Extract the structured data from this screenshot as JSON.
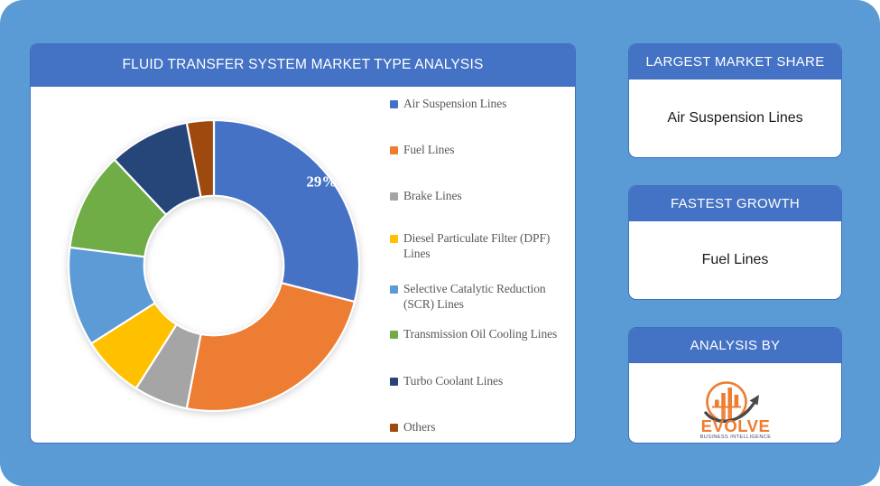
{
  "theme": {
    "background_blue": "#5B9BD5",
    "header_blue": "#4472C4",
    "panel_white": "#FFFFFF",
    "legend_text": "#595959"
  },
  "chart_panel": {
    "title": "FLUID TRANSFER SYSTEM MARKET TYPE ANALYSIS"
  },
  "chart_data": {
    "type": "pie",
    "variant": "donut",
    "title": "FLUID TRANSFER SYSTEM MARKET TYPE ANALYSIS",
    "xlabel": "",
    "ylabel": "",
    "legend_position": "right",
    "grid": false,
    "hole_ratio": 0.48,
    "start_angle_deg": 0,
    "direction": "clockwise",
    "categories": [
      "Air Suspension Lines",
      "Fuel Lines",
      "Brake Lines",
      "Diesel Particulate Filter (DPF) Lines",
      "Selective Catalytic Reduction (SCR) Lines",
      "Transmission Oil Cooling Lines",
      "Turbo Coolant Lines",
      "Others"
    ],
    "values": [
      29,
      24,
      6,
      7,
      11,
      11,
      9,
      3
    ],
    "colors": [
      "#4472C4",
      "#ED7D31",
      "#A5A5A5",
      "#FFC000",
      "#5B9BD5",
      "#70AD47",
      "#264478",
      "#9E480E"
    ],
    "data_labels": [
      {
        "category": "Air Suspension Lines",
        "text": "29%"
      }
    ]
  },
  "legend": {
    "items": [
      {
        "label": "Air Suspension Lines",
        "color": "#4472C4"
      },
      {
        "label": "Fuel Lines",
        "color": "#ED7D31"
      },
      {
        "label": "Brake Lines",
        "color": "#A5A5A5"
      },
      {
        "label": "Diesel Particulate Filter (DPF) Lines",
        "color": "#FFC000"
      },
      {
        "label": "Selective Catalytic Reduction (SCR) Lines",
        "color": "#5B9BD5"
      },
      {
        "label": "Transmission Oil Cooling Lines",
        "color": "#70AD47"
      },
      {
        "label": "Turbo Coolant Lines",
        "color": "#264478"
      },
      {
        "label": "Others",
        "color": "#9E480E"
      }
    ]
  },
  "cards": {
    "largest_market_share": {
      "title": "LARGEST MARKET SHARE",
      "value": "Air Suspension Lines"
    },
    "fastest_growth": {
      "title": "FASTEST GROWTH",
      "value": "Fuel Lines"
    },
    "analysis_by": {
      "title": "ANALYSIS BY",
      "logo_name": "EVOLVE",
      "logo_tagline": "BUSINESS INTELLIGENCE",
      "logo_icon": "evolve-growth-chart-arrow-logo"
    }
  }
}
